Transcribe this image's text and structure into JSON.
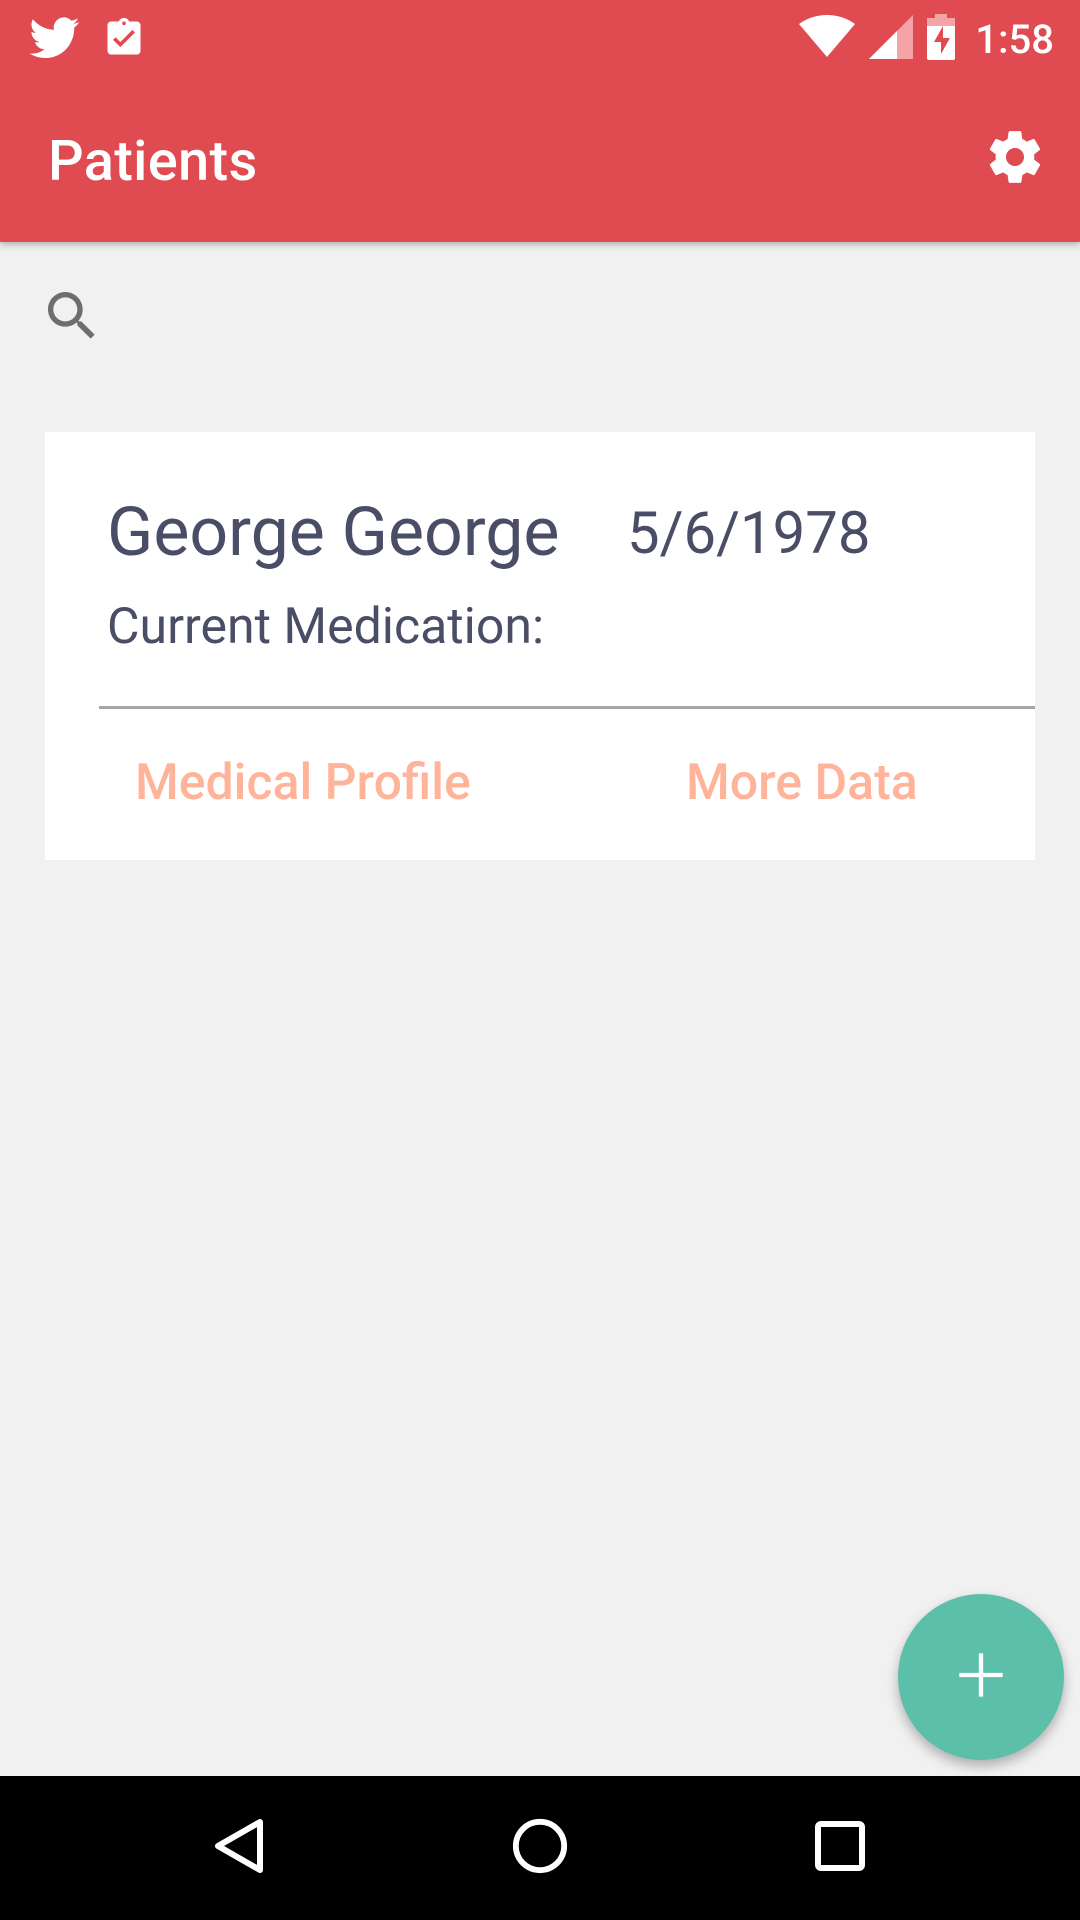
{
  "status_bar": {
    "time": "1:58",
    "left_icons": [
      "twitter-icon",
      "clipboard-check-icon"
    ],
    "right_icons": [
      "wifi-icon",
      "cell-signal-icon",
      "battery-charging-icon"
    ]
  },
  "toolbar": {
    "title": "Patients",
    "settings_icon": "gear-icon"
  },
  "search": {
    "icon": "search-icon"
  },
  "patients": [
    {
      "name": "George George",
      "dob": "5/6/1978",
      "medication_label": "Current Medication:",
      "actions": {
        "medical_profile": "Medical Profile",
        "more_data": "More Data"
      }
    }
  ],
  "fab": {
    "icon": "plus-icon"
  },
  "nav_bar": {
    "icons": [
      "back-icon",
      "home-icon",
      "recents-icon"
    ]
  },
  "colors": {
    "primary": "#e04b52",
    "accent": "#5bbfaa",
    "action_text": "#ffb399",
    "card_text": "#4a4d66",
    "background": "#f1f1f1"
  }
}
